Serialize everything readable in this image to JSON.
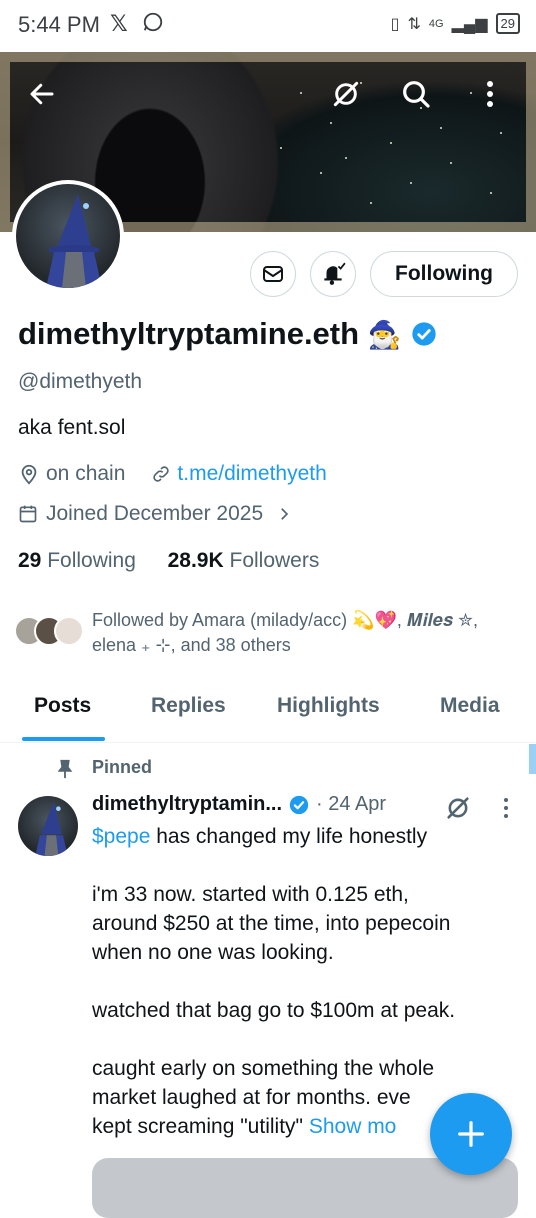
{
  "status_bar": {
    "time": "5:44 PM",
    "x_icon": "x-logo-icon",
    "whatsapp_icon": "whatsapp-icon",
    "network": "4G",
    "battery": "29"
  },
  "profile": {
    "display_name": "dimethyltryptamine.eth",
    "name_emoji": "🧙‍♂️",
    "handle": "@dimethyeth",
    "bio": "aka fent.sol",
    "location": "on chain",
    "website": "t.me/dimethyeth",
    "joined": "Joined December 2025",
    "following_count": "29",
    "following_label": "Following",
    "followers_count": "28.9K",
    "followers_label": "Followers",
    "followed_by": "Followed by Amara (milady/acc) 💫💖, 𝑴𝒊𝒍𝒆𝒔 ✮, elena ₊ ⊹, and 38 others"
  },
  "actions": {
    "following_button": "Following"
  },
  "tabs": [
    {
      "label": "Posts",
      "active": true
    },
    {
      "label": "Replies",
      "active": false
    },
    {
      "label": "Highlights",
      "active": false
    },
    {
      "label": "Media",
      "active": false
    }
  ],
  "post": {
    "pinned_label": "Pinned",
    "author_name": "dimethyltryptamin...",
    "date": "· 24 Apr",
    "cashtag": "$pepe",
    "text_after_cashtag": " has changed my life honestly\n\ni'm 33 now. started with 0.125 eth,\naround $250 at the time, into pepecoin\nwhen no one was looking.\n\nwatched that bag go to $100m at peak.\n\ncaught early on something the whole\nmarket laughed at for months. eve",
    "text_tail": "kept screaming \"utility\" ",
    "show_more": "Show mo"
  },
  "colors": {
    "accent": "#1d9bf0",
    "text_primary": "#0f1419",
    "text_secondary": "#536471"
  }
}
